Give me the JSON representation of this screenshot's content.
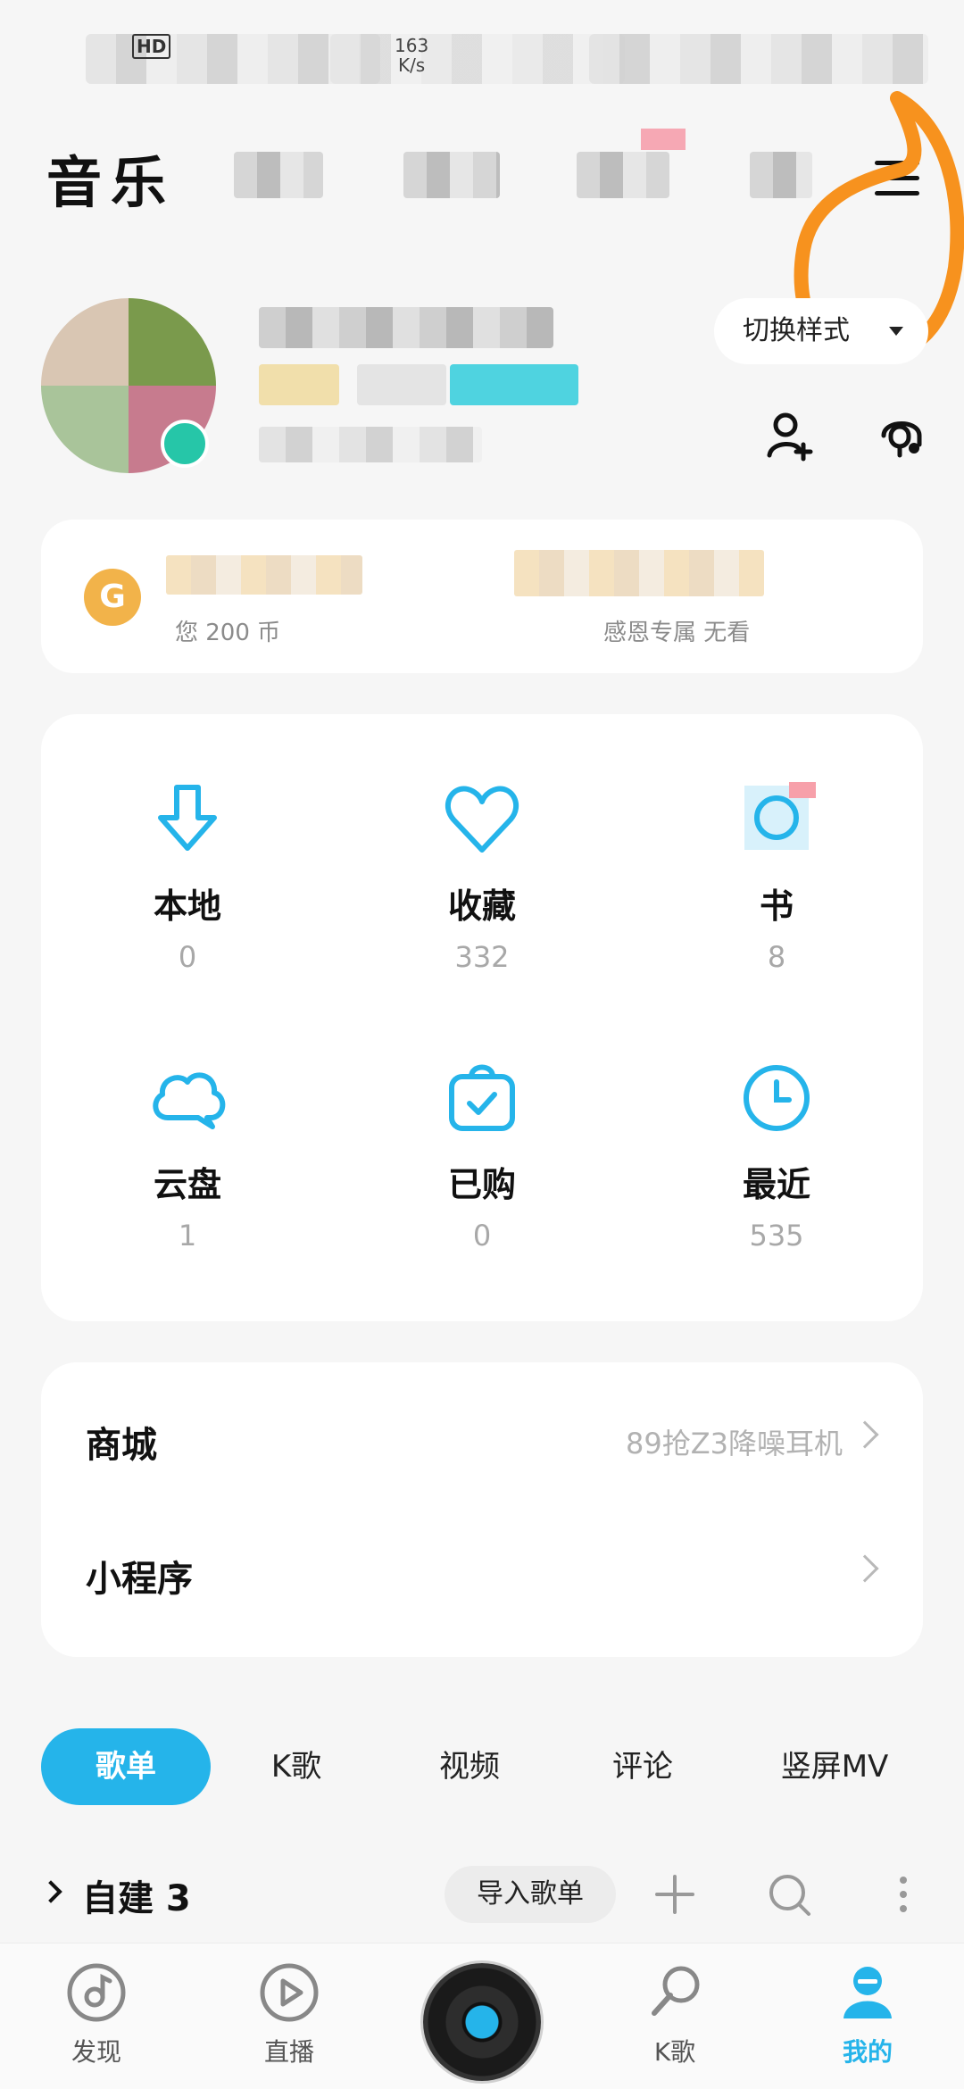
{
  "status_bar": {
    "hd": "HD",
    "speed_value": "163",
    "speed_unit": "K/s"
  },
  "top_nav": {
    "title": "音乐"
  },
  "profile": {
    "switch_style_label": "切换样式"
  },
  "vip_card": {
    "coin_symbol": "G",
    "coin_text": "您 200 币",
    "vip_text": "感恩专属 无看"
  },
  "grid": [
    {
      "label": "本地",
      "count": "0",
      "icon": "download-icon"
    },
    {
      "label": "收藏",
      "count": "332",
      "icon": "heart-icon"
    },
    {
      "label": "书",
      "count": "8",
      "icon": "audiobook-icon"
    },
    {
      "label": "云盘",
      "count": "1",
      "icon": "cloud-icon"
    },
    {
      "label": "已购",
      "count": "0",
      "icon": "purchased-bag-icon"
    },
    {
      "label": "最近",
      "count": "535",
      "icon": "clock-icon"
    }
  ],
  "list": {
    "shop_label": "商城",
    "shop_promo": "89抢Z3降噪耳机",
    "miniapp_label": "小程序"
  },
  "content_tabs": [
    "歌单",
    "K歌",
    "视频",
    "评论",
    "竖屏MV"
  ],
  "playlist": {
    "title": "自建 3",
    "import_label": "导入歌单"
  },
  "bottom_nav": [
    "发现",
    "直播",
    "K歌",
    "我的"
  ],
  "colors": {
    "accent": "#25b4ea",
    "annotation": "#f7921e"
  }
}
